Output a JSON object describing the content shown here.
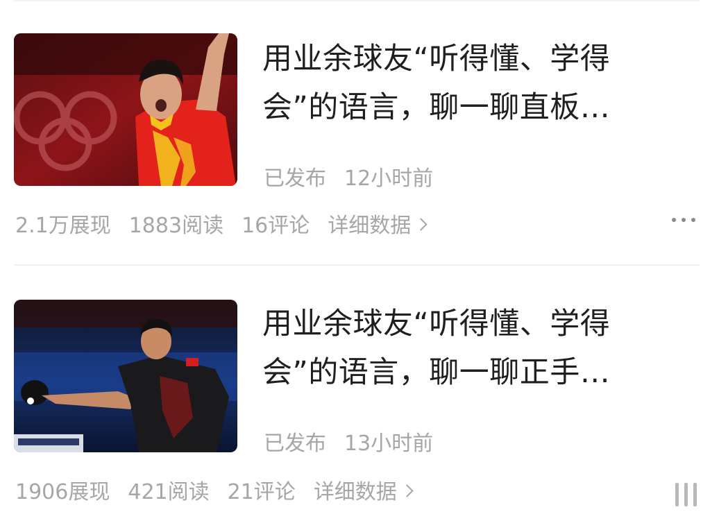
{
  "articles": [
    {
      "title_line1": "用业余球友“听得懂、学得",
      "title_line2": "会”的语言，聊一聊直板…",
      "published_label": "已发布",
      "published_time": "12小时前",
      "impressions": "2.1万展现",
      "reads": "1883阅读",
      "comments": "16评论",
      "details_label": "详细数据"
    },
    {
      "title_line1": "用业余球友“听得懂、学得",
      "title_line2": "会”的语言，聊一聊正手…",
      "published_label": "已发布",
      "published_time": "13小时前",
      "impressions": "1906展现",
      "reads": "421阅读",
      "comments": "21评论",
      "details_label": "详细数据"
    }
  ],
  "icons": {
    "more": "more-dots-icon",
    "scroll": "scroll-handle-icon",
    "chevron": "chevron-right-icon"
  },
  "colors": {
    "title": "#1f1f1f",
    "meta": "#a6a6a6",
    "divider": "#f1f1f1"
  }
}
